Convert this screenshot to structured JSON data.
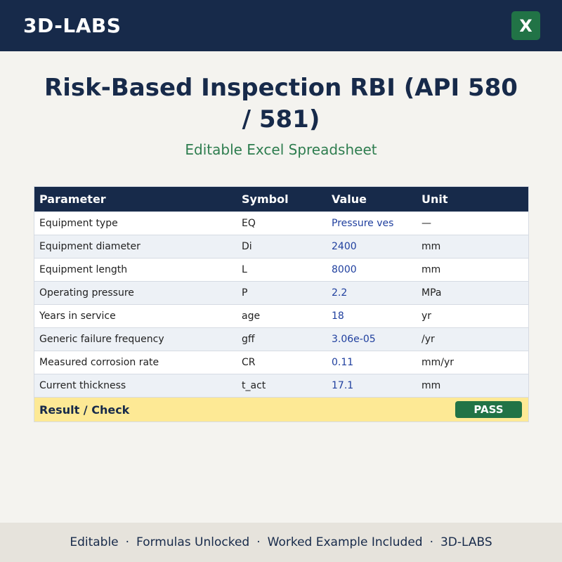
{
  "header": {
    "brand": "3D-LABS",
    "excel_icon_glyph": "X",
    "excel_icon": "excel-icon"
  },
  "title": "Risk-Based Inspection RBI (API 580 / 581)",
  "subtitle": "Editable Excel Spreadsheet",
  "table": {
    "columns": [
      "Parameter",
      "Symbol",
      "Value",
      "Unit"
    ],
    "rows": [
      {
        "parameter": "Equipment type",
        "symbol": "EQ",
        "value": "Pressure ves",
        "unit": "—"
      },
      {
        "parameter": "Equipment diameter",
        "symbol": "Di",
        "value": "2400",
        "unit": "mm"
      },
      {
        "parameter": "Equipment length",
        "symbol": "L",
        "value": "8000",
        "unit": "mm"
      },
      {
        "parameter": "Operating pressure",
        "symbol": "P",
        "value": "2.2",
        "unit": "MPa"
      },
      {
        "parameter": "Years in service",
        "symbol": "age",
        "value": "18",
        "unit": "yr"
      },
      {
        "parameter": "Generic failure frequency",
        "symbol": "gff",
        "value": "3.06e-05",
        "unit": "/yr"
      },
      {
        "parameter": "Measured corrosion rate",
        "symbol": "CR",
        "value": "0.11",
        "unit": "mm/yr"
      },
      {
        "parameter": "Current thickness",
        "symbol": "t_act",
        "value": "17.1",
        "unit": "mm"
      }
    ],
    "result_label": "Result / Check",
    "result_status": "PASS"
  },
  "footer": {
    "items": [
      "Editable",
      "Formulas Unlocked",
      "Worked Example Included",
      "3D-LABS"
    ],
    "separator": "·"
  },
  "colors": {
    "navy": "#172a4a",
    "excel_green": "#217346",
    "subtitle_green": "#2e7d4f",
    "value_blue": "#1f3f9e",
    "result_yellow": "#fde995"
  }
}
